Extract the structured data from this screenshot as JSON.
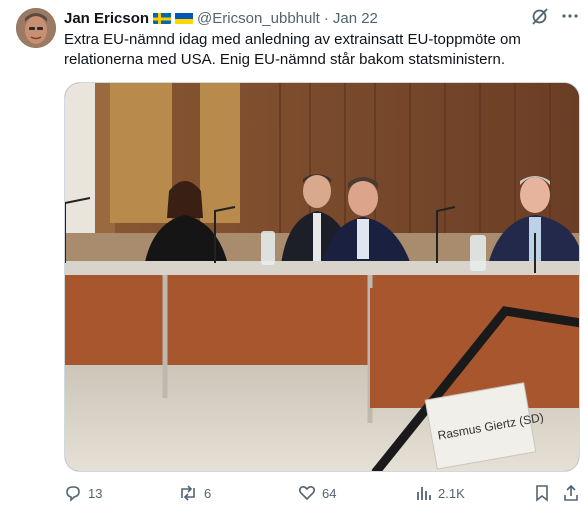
{
  "author": {
    "name": "Jan Ericson",
    "handle": "@Ericson_ubbhult",
    "separator": "·",
    "date": "Jan 22",
    "flags": [
      "sweden-flag-icon",
      "ukraine-flag-icon"
    ]
  },
  "tweet": {
    "text_line1": "Extra EU-nämnd idag med anledning av extrainsatt EU-toppmöte om",
    "text_line2": "relationerna med USA. Enig EU-nämnd står bakom statsministern."
  },
  "photo": {
    "nameplate": "Rasmus Giertz (SD)"
  },
  "actions": {
    "replies": "13",
    "reposts": "6",
    "likes": "64",
    "views": "2.1K"
  },
  "colors": {
    "text": "#0f1419",
    "secondary": "#536471",
    "border": "#cfd9de"
  }
}
